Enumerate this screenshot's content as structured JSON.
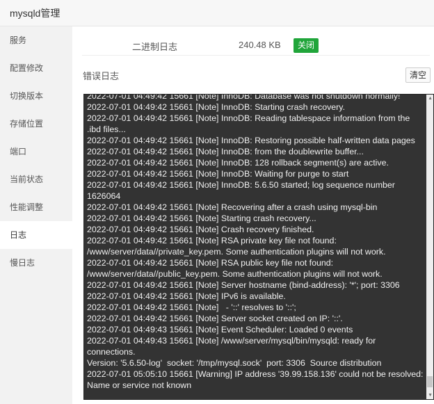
{
  "window": {
    "title": "mysqld管理"
  },
  "sidebar": {
    "items": [
      {
        "label": "服务"
      },
      {
        "label": "配置修改"
      },
      {
        "label": "切换版本"
      },
      {
        "label": "存储位置"
      },
      {
        "label": "端口"
      },
      {
        "label": "当前状态"
      },
      {
        "label": "性能调整"
      },
      {
        "label": "日志",
        "active": true
      },
      {
        "label": "慢日志"
      }
    ]
  },
  "binlog": {
    "label": "二进制日志",
    "size": "240.48 KB",
    "toggle_label": "关闭",
    "toggle_color": "#20a53a"
  },
  "error_log": {
    "label": "错误日志",
    "clear_label": "清空",
    "lines": [
      "2022-07-01 04:49:42 15661 [Note] InnoDB: Database was not shutdown normally!",
      "2022-07-01 04:49:42 15661 [Note] InnoDB: Starting crash recovery.",
      "2022-07-01 04:49:42 15661 [Note] InnoDB: Reading tablespace information from the .ibd files...",
      "2022-07-01 04:49:42 15661 [Note] InnoDB: Restoring possible half-written data pages",
      "2022-07-01 04:49:42 15661 [Note] InnoDB: from the doublewrite buffer...",
      "2022-07-01 04:49:42 15661 [Note] InnoDB: 128 rollback segment(s) are active.",
      "2022-07-01 04:49:42 15661 [Note] InnoDB: Waiting for purge to start",
      "2022-07-01 04:49:42 15661 [Note] InnoDB: 5.6.50 started; log sequence number 1626064",
      "2022-07-01 04:49:42 15661 [Note] Recovering after a crash using mysql-bin",
      "2022-07-01 04:49:42 15661 [Note] Starting crash recovery...",
      "2022-07-01 04:49:42 15661 [Note] Crash recovery finished.",
      "2022-07-01 04:49:42 15661 [Note] RSA private key file not found: /www/server/data//private_key.pem. Some authentication plugins will not work.",
      "2022-07-01 04:49:42 15661 [Note] RSA public key file not found: /www/server/data//public_key.pem. Some authentication plugins will not work.",
      "2022-07-01 04:49:42 15661 [Note] Server hostname (bind-address): '*'; port: 3306",
      "2022-07-01 04:49:42 15661 [Note] IPv6 is available.",
      "2022-07-01 04:49:42 15661 [Note]   - '::' resolves to '::';",
      "2022-07-01 04:49:42 15661 [Note] Server socket created on IP: '::'.",
      "2022-07-01 04:49:43 15661 [Note] Event Scheduler: Loaded 0 events",
      "2022-07-01 04:49:43 15661 [Note] /www/server/mysql/bin/mysqld: ready for connections.",
      "Version: '5.6.50-log'  socket: '/tmp/mysql.sock'  port: 3306  Source distribution",
      "2022-07-01 05:05:10 15661 [Warning] IP address '39.99.158.136' could not be resolved: Name or service not known"
    ]
  }
}
